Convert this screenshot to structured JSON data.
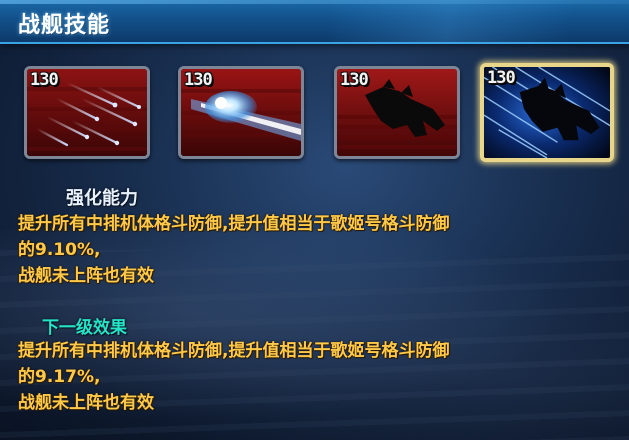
{
  "header": {
    "title": "战舰技能"
  },
  "skills": [
    {
      "level": "130",
      "art": "laser-streaks-icon"
    },
    {
      "level": "130",
      "art": "energy-beam-icon"
    },
    {
      "level": "130",
      "art": "mecha-silhouette-icon"
    },
    {
      "level": "130",
      "art": "mecha-dash-icon",
      "selected": true
    }
  ],
  "current": {
    "title": "强化能力",
    "line1": "提升所有中排机体格斗防御,提升值相当于歌姬号格斗防御",
    "line2": "的9.10%,",
    "line3": "战舰未上阵也有效"
  },
  "next": {
    "title": "下一级效果",
    "line1": "提升所有中排机体格斗防御,提升值相当于歌姬号格斗防御",
    "line2": "的9.17%,",
    "line3": "战舰未上阵也有效"
  },
  "colors": {
    "header": "#1a6aa8",
    "desc_text": "#ffc94a",
    "next_title": "#23e5c8",
    "selected_border": "#e8d78a"
  }
}
